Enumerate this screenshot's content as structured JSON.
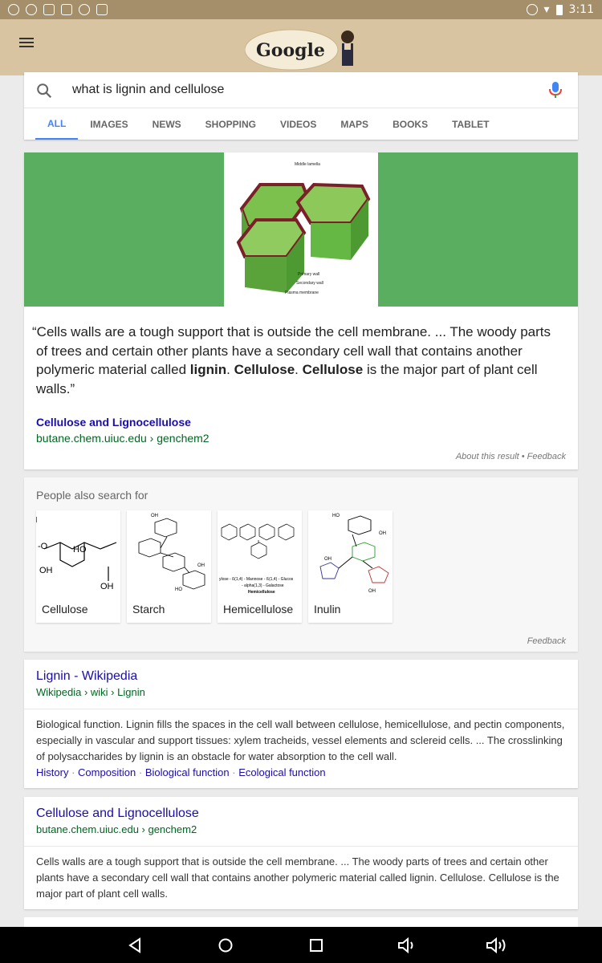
{
  "status_bar": {
    "time": "3:11"
  },
  "header": {
    "doodle_alt": "Google"
  },
  "search": {
    "query": "what is lignin and cellulose"
  },
  "tabs": [
    {
      "label": "ALL"
    },
    {
      "label": "IMAGES"
    },
    {
      "label": "NEWS"
    },
    {
      "label": "SHOPPING"
    },
    {
      "label": "VIDEOS"
    },
    {
      "label": "MAPS"
    },
    {
      "label": "BOOKS"
    },
    {
      "label": "TABLET"
    }
  ],
  "snippet": {
    "image_labels": [
      "Middle lamella",
      "Primary wall",
      "Secondary wall",
      "Plasma membrane"
    ],
    "quote_parts": [
      "“Cells walls are a tough support that is outside the cell membrane. ... The woody parts of trees and certain other plants have a secondary cell wall that contains another polymeric material called ",
      "lignin",
      ". ",
      "Cellulose",
      ". ",
      "Cellulose",
      " is the major part of plant cell walls.”"
    ],
    "title": "Cellulose and Lignocellulose",
    "url": "butane.chem.uiuc.edu › genchem2",
    "meta": "About this result • Feedback"
  },
  "people_also_search": {
    "title": "People also search for",
    "items": [
      {
        "label": "Cellulose"
      },
      {
        "label": "Starch"
      },
      {
        "label": "Hemicellulose"
      },
      {
        "label": "Inulin"
      }
    ],
    "feedback": "Feedback"
  },
  "results": [
    {
      "title": "Lignin - Wikipedia",
      "url": "Wikipedia › wiki › Lignin",
      "body": "Biological function. Lignin fills the spaces in the cell wall between cellulose, hemicellulose, and pectin components, especially in vascular and support tissues: xylem tracheids, vessel elements and sclereid cells. ... The crosslinking of polysaccharides by lignin is an obstacle for water absorption to the cell wall.",
      "sitelinks": [
        "History",
        "Composition",
        "Biological function",
        "Ecological function"
      ]
    },
    {
      "title": "Cellulose and Lignocellulose",
      "url": "butane.chem.uiuc.edu › genchem2",
      "body": "Cells walls are a tough support that is outside the cell membrane. ... The woody parts of trees and certain other plants have a secondary cell wall that contains another polymeric material called lignin. Cellulose. Cellulose is the major part of plant cell walls."
    }
  ],
  "colors": {
    "accent": "#4285f4",
    "link": "#1a0dab",
    "url": "#006621",
    "banner": "#5aae60"
  }
}
